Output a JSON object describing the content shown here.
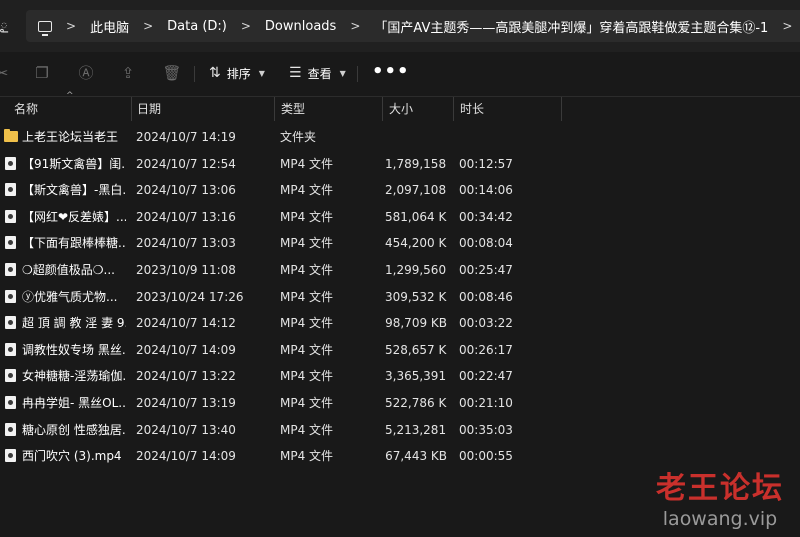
{
  "address_bar": {
    "left_glyph": "ౖ",
    "separator": ">",
    "crumbs": [
      "此电脑",
      "Data (D:)",
      "Downloads",
      "「国产AV主题秀——高跟美腿冲到爆」穿着高跟鞋做爱主题合集⑫-1"
    ]
  },
  "toolbar": {
    "sort_label": "排序",
    "view_label": "查看",
    "more_label": "•••"
  },
  "columns": {
    "name": "名称",
    "date": "日期",
    "type": "类型",
    "size": "大小",
    "duration": "时长"
  },
  "files": [
    {
      "kind": "folder",
      "name": "上老王论坛当老王",
      "date": "2024/10/7 14:19",
      "type": "文件夹",
      "size": "",
      "duration": ""
    },
    {
      "kind": "video",
      "name": "【91斯文禽兽】闺...",
      "date": "2024/10/7 12:54",
      "type": "MP4 文件",
      "size": "1,789,158...",
      "duration": "00:12:57"
    },
    {
      "kind": "video",
      "name": "【斯文禽兽】-黑白...",
      "date": "2024/10/7 13:06",
      "type": "MP4 文件",
      "size": "2,097,108...",
      "duration": "00:14:06"
    },
    {
      "kind": "video",
      "name": "【网红❤反差婊】...",
      "date": "2024/10/7 13:16",
      "type": "MP4 文件",
      "size": "581,064 KB",
      "duration": "00:34:42"
    },
    {
      "kind": "video",
      "name": "【下面有跟棒棒糖...",
      "date": "2024/10/7 13:03",
      "type": "MP4 文件",
      "size": "454,200 KB",
      "duration": "00:08:04"
    },
    {
      "kind": "video",
      "name": "❍超颜值极品❍...",
      "date": "2023/10/9 11:08",
      "type": "MP4 文件",
      "size": "1,299,560...",
      "duration": "00:25:47"
    },
    {
      "kind": "video",
      "name": "ⓨ优雅气质尤物...",
      "date": "2023/10/24 17:26",
      "type": "MP4 文件",
      "size": "309,532 KB",
      "duration": "00:08:46"
    },
    {
      "kind": "video",
      "name": "超 頂 調 教 淫 妻 9...",
      "date": "2024/10/7 14:12",
      "type": "MP4 文件",
      "size": "98,709 KB",
      "duration": "00:03:22"
    },
    {
      "kind": "video",
      "name": "调教性奴专场 黑丝...",
      "date": "2024/10/7 14:09",
      "type": "MP4 文件",
      "size": "528,657 KB",
      "duration": "00:26:17"
    },
    {
      "kind": "video",
      "name": "女神糖糖-淫荡瑜伽...",
      "date": "2024/10/7 13:22",
      "type": "MP4 文件",
      "size": "3,365,391...",
      "duration": "00:22:47"
    },
    {
      "kind": "video",
      "name": "冉冉学姐- 黑丝OL...",
      "date": "2024/10/7 13:19",
      "type": "MP4 文件",
      "size": "522,786 KB",
      "duration": "00:21:10"
    },
    {
      "kind": "video",
      "name": "糖心原创 性感独居...",
      "date": "2024/10/7 13:40",
      "type": "MP4 文件",
      "size": "5,213,281...",
      "duration": "00:35:03"
    },
    {
      "kind": "video",
      "name": "西门吹穴 (3).mp4",
      "date": "2024/10/7 14:09",
      "type": "MP4 文件",
      "size": "67,443 KB",
      "duration": "00:00:55"
    }
  ],
  "watermark": {
    "chinese": "老王论坛",
    "url": "laowang.vip"
  },
  "colors": {
    "background": "#191919",
    "address_bg": "#2b2b2b",
    "folder": "#f0c04a",
    "watermark_red": "#c9302c"
  }
}
